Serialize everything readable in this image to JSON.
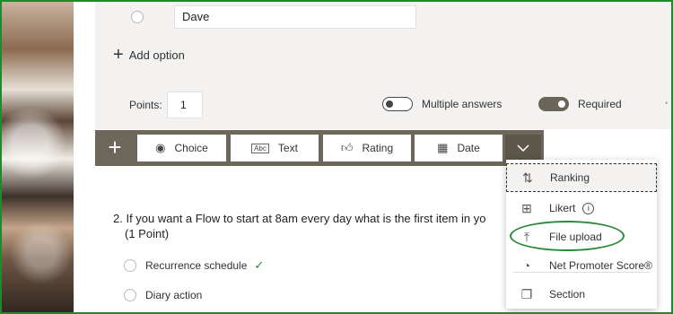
{
  "question1": {
    "option_value": "Dave",
    "add_option_label": "Add option",
    "points_label": "Points:",
    "points_value": "1",
    "multiple_answers_label": "Multiple answers",
    "required_label": "Required",
    "more_label": "···"
  },
  "toolbar": {
    "add": "+",
    "choice": "Choice",
    "text": "Text",
    "rating": "Rating",
    "date": "Date"
  },
  "question2": {
    "title": "2. If you want a Flow to start at 8am every day what is the first item in yo",
    "points": "(1 Point)",
    "answers": [
      "Recurrence schedule",
      "Diary action"
    ]
  },
  "dropdown": {
    "items": [
      "Ranking",
      "Likert",
      "File upload",
      "Net Promoter Score®",
      "Section"
    ]
  },
  "colors": {
    "toolbar": "#6d665b",
    "accent_green": "#1f8a2b"
  }
}
